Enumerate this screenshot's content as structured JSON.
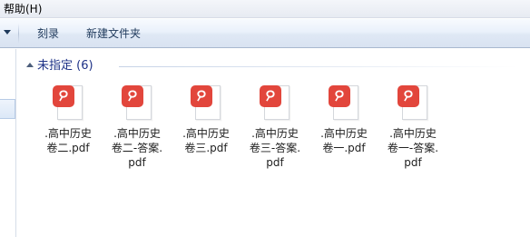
{
  "menubar": {
    "help": "帮助(H)"
  },
  "toolbar": {
    "burn": "刻录",
    "new_folder": "新建文件夹"
  },
  "group": {
    "title": "未指定 (6)"
  },
  "files": [
    {
      "name_line1": ".高中历史",
      "name_line2": "卷二.pdf",
      "name_line3": ""
    },
    {
      "name_line1": ".高中历史",
      "name_line2": "卷二-答案.",
      "name_line3": "pdf"
    },
    {
      "name_line1": ".高中历史",
      "name_line2": "卷三.pdf",
      "name_line3": ""
    },
    {
      "name_line1": ".高中历史",
      "name_line2": "卷三-答案.",
      "name_line3": "pdf"
    },
    {
      "name_line1": ".高中历史",
      "name_line2": "卷一.pdf",
      "name_line3": ""
    },
    {
      "name_line1": ".高中历史",
      "name_line2": "卷一-答案.",
      "name_line3": "pdf"
    }
  ],
  "colors": {
    "pdf_badge": "#e2463c",
    "group_title": "#1e3287"
  }
}
